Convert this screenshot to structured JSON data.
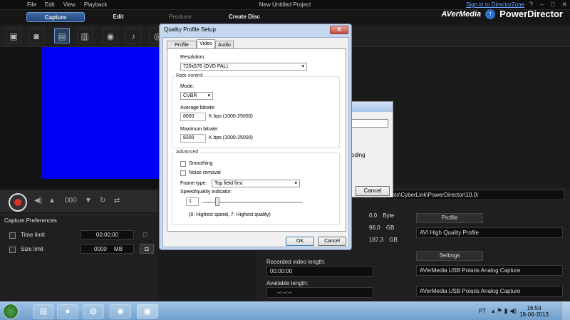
{
  "menu": [
    "File",
    "Edit",
    "View",
    "Playback"
  ],
  "project_title": "New Untitled Project",
  "signin_link": "Sign in to DirectorZone",
  "brand": {
    "company": "AVerMedia",
    "product": "PowerDirector"
  },
  "tabs": {
    "capture": "Capture",
    "edit": "Edit",
    "produce": "Produce",
    "create_disc": "Create Disc"
  },
  "controls": {
    "counter": "000"
  },
  "capture_preferences": {
    "header": "Capture Preferences",
    "time_limit_label": "Time limit",
    "time_limit_value": "00:00:00",
    "size_limit_label": "Size limit",
    "size_limit_value": "0000",
    "size_unit": "MB"
  },
  "right_panel": {
    "path": "ents\\CyberLink\\PowerDirector\\10.0\\",
    "stats": [
      {
        "value": "0.0",
        "unit": "Byte"
      },
      {
        "value": "96.0",
        "unit": "GB"
      },
      {
        "value": "187.3",
        "unit": "GB"
      }
    ],
    "profile_button": "Profile",
    "profile_value": "AVI High Quality Profile",
    "settings_button": "Settings",
    "settings_value_1": "AVerMedia USB Polaris Analog Capture",
    "settings_value_2": "AVerMedia USB Polaris Analog Capture",
    "recorded_label": "Recorded video length:",
    "recorded_value": "00:00:00",
    "available_label": "Available length:",
    "available_value": "--:--:--"
  },
  "back_dialog": {
    "text": "oding",
    "cancel": "Cancel"
  },
  "dialog": {
    "title": "Quality Profile Setup",
    "close": "X",
    "tabs": [
      "Profile Name",
      "Video",
      "Audio"
    ],
    "resolution_label": "Resolution:",
    "resolution_value": "720x576 (DVD PAL)",
    "rate_control_label": "Rate control",
    "mode_label": "Mode:",
    "mode_value": "CVBR",
    "avg_bitrate_label": "Average bitrate:",
    "avg_bitrate_value": "8000",
    "avg_bitrate_unit": "K bps (1000-25000)",
    "max_bitrate_label": "Maximum bitrate:",
    "max_bitrate_value": "8300",
    "max_bitrate_unit": "K bps (1000-25000)",
    "advanced_label": "Advanced",
    "smoothing_label": "Smoothing",
    "noise_label": "Noise removal",
    "frame_type_label": "Frame type:",
    "frame_type_value": "Top field first",
    "speed_label": "Speed/quality indicator:",
    "speed_value": "1",
    "speed_hint": "(0: Highest speed, 7: Highest quality)",
    "ok": "OK",
    "cancel": "Cancel"
  },
  "taskbar": {
    "lang": "PT",
    "time": "16:54",
    "date": "18-06-2013"
  }
}
